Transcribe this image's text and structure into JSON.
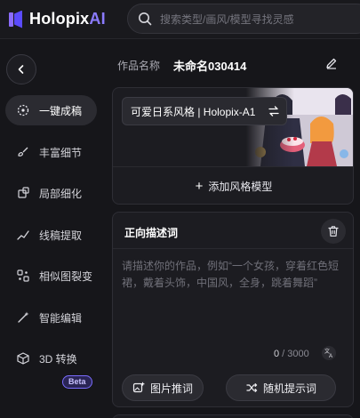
{
  "brand": {
    "name": "Holopix",
    "suffix": "AI"
  },
  "search": {
    "placeholder": "搜索类型/画风/模型寻找灵感"
  },
  "sidebar": {
    "items": [
      {
        "label": "一键成稿",
        "icon": "sparkle-dots-icon",
        "active": true
      },
      {
        "label": "丰富细节",
        "icon": "paint-brush-icon",
        "active": false
      },
      {
        "label": "局部细化",
        "icon": "crop-refine-icon",
        "active": false
      },
      {
        "label": "线稿提取",
        "icon": "line-draw-icon",
        "active": false
      },
      {
        "label": "相似图裂变",
        "icon": "variation-icon",
        "active": false
      },
      {
        "label": "智能编辑",
        "icon": "magic-wand-icon",
        "active": false
      },
      {
        "label": "3D 转换",
        "icon": "cube-icon",
        "active": false
      }
    ],
    "beta_badge": "Beta"
  },
  "work": {
    "label": "作品名称",
    "name": "未命名030414"
  },
  "style": {
    "selected": "可爱日系风格 | Holopix-A1",
    "add_label": "添加风格模型"
  },
  "prompt": {
    "title": "正向描述词",
    "placeholder": "请描述你的作品，例如“一个女孩，穿着红色短裙，戴着头饰，中国风，全身，跳着舞蹈”",
    "count": "0",
    "max": "3000",
    "image_prompt_label": "图片推词",
    "random_prompt_label": "随机提示词"
  },
  "colors": {
    "background": "#16161a",
    "panel": "#1c1c21",
    "accent": "#8b7bff",
    "active_item": "#2b2b31"
  }
}
